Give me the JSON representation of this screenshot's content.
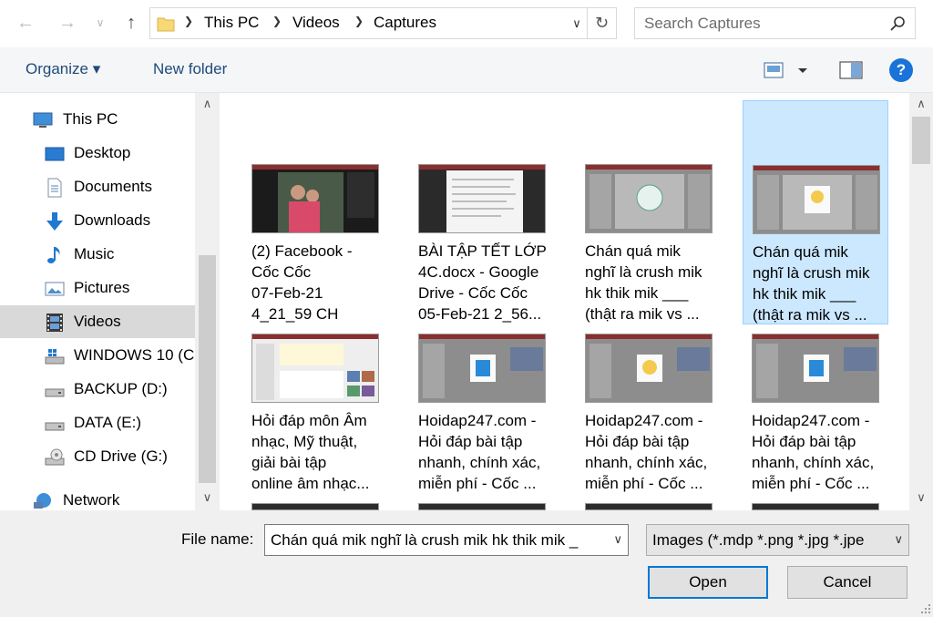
{
  "breadcrumb": [
    "This PC",
    "Videos",
    "Captures"
  ],
  "search": {
    "placeholder": "Search Captures"
  },
  "toolbar": {
    "organize_label": "Organize ▾",
    "new_folder_label": "New folder",
    "help_label": "?"
  },
  "nav": {
    "items": [
      {
        "label": "This PC",
        "icon": "computer-icon"
      },
      {
        "label": "Desktop",
        "icon": "desktop-icon"
      },
      {
        "label": "Documents",
        "icon": "documents-icon"
      },
      {
        "label": "Downloads",
        "icon": "download-arrow-icon"
      },
      {
        "label": "Music",
        "icon": "music-note-icon"
      },
      {
        "label": "Pictures",
        "icon": "pictures-icon"
      },
      {
        "label": "Videos",
        "icon": "film-strip-icon",
        "selected": true
      },
      {
        "label": "WINDOWS 10 (C",
        "icon": "windows-drive-icon"
      },
      {
        "label": "BACKUP (D:)",
        "icon": "drive-icon"
      },
      {
        "label": "DATA (E:)",
        "icon": "drive-icon"
      },
      {
        "label": "CD Drive (G:)",
        "icon": "cd-drive-icon"
      },
      {
        "label": "Network",
        "icon": "network-icon"
      }
    ]
  },
  "files": [
    {
      "label": "(2) Facebook -\nCốc Cốc\n07-Feb-21\n4_21_59 CH"
    },
    {
      "label": "BÀI TẬP TẾT LỚP\n4C.docx - Google\nDrive - Cốc Cốc\n05-Feb-21 2_56..."
    },
    {
      "label": "Chán quá mik\nnghĩ là crush mik\nhk thik mik ___\n(thật ra mik vs ..."
    },
    {
      "label": "Chán quá mik\nnghĩ là crush mik\nhk thik mik ___\n(thật ra mik vs ...",
      "selected": true
    },
    {
      "label": "Hỏi đáp môn Âm\nnhạc, Mỹ thuật,\ngiải bài tập\nonline âm nhạc..."
    },
    {
      "label": "Hoidap247.com -\nHỏi đáp bài tập\nnhanh, chính xác,\nmiễn phí - Cốc ..."
    },
    {
      "label": "Hoidap247.com -\nHỏi đáp bài tập\nnhanh, chính xác,\nmiễn phí - Cốc ..."
    },
    {
      "label": "Hoidap247.com -\nHỏi đáp bài tập\nnhanh, chính xác,\nmiễn phí - Cốc ..."
    }
  ],
  "bottom": {
    "filename_label": "File name:",
    "filename_value": "Chán quá mik nghĩ là crush mik hk thik mik _",
    "filetype_value": "Images (*.mdp *.png *.jpg *.jpe",
    "open_label": "Open",
    "cancel_label": "Cancel"
  },
  "colors": {
    "accent": "#0078d7",
    "selection": "#cce8ff",
    "link": "#1f4a7a",
    "help": "#1a73d9"
  }
}
